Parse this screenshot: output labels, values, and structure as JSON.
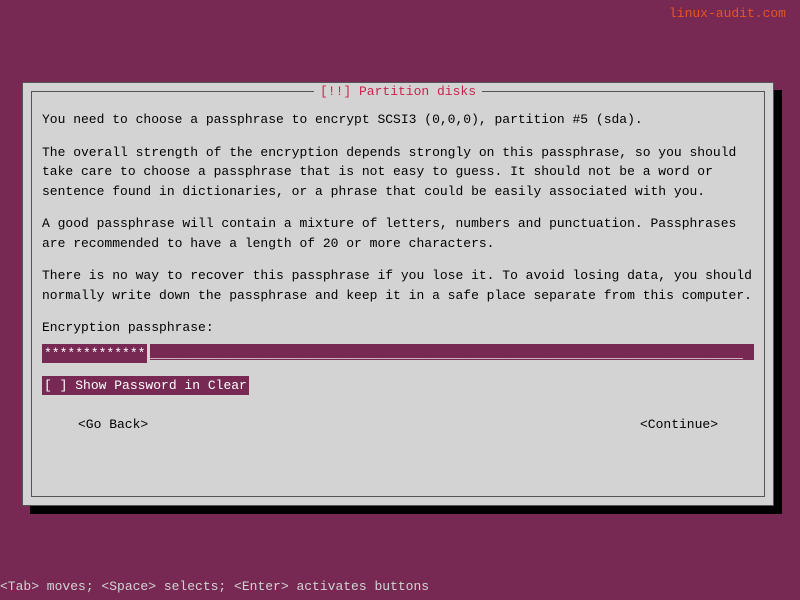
{
  "watermark": "linux-audit.com",
  "dialog": {
    "title": "[!!] Partition disks",
    "paragraphs": {
      "p1": "You need to choose a passphrase to encrypt SCSI3 (0,0,0), partition #5 (sda).",
      "p2": "The overall strength of the encryption depends strongly on this passphrase, so you should take care to choose a passphrase that is not easy to guess. It should not be a word or sentence found in dictionaries, or a phrase that could be easily associated with you.",
      "p3": "A good passphrase will contain a mixture of letters, numbers and punctuation. Passphrases are recommended to have a length of 20 or more characters.",
      "p4": "There is no way to recover this passphrase if you lose it. To avoid losing data, you should normally write down the passphrase and keep it in a safe place separate from this computer."
    },
    "passphrase_label": "Encryption passphrase:",
    "passphrase_value": "*************",
    "passphrase_fill": "____________________________________________________________________________",
    "checkbox": {
      "state": "[ ]",
      "label": "Show Password in Clear"
    },
    "buttons": {
      "back": "<Go Back>",
      "continue": "<Continue>"
    }
  },
  "footer": "<Tab> moves; <Space> selects; <Enter> activates buttons"
}
